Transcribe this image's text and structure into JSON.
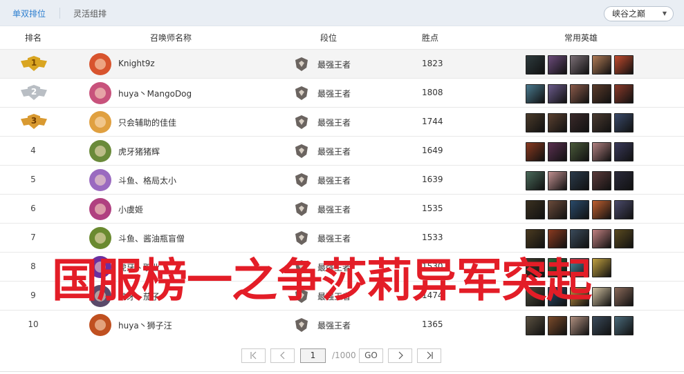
{
  "tabs": [
    {
      "label": "单双排位",
      "active": true
    },
    {
      "label": "灵活组排",
      "active": false
    }
  ],
  "region_select": {
    "value": "峡谷之巅",
    "chevron_icon": "chevron-down-icon"
  },
  "columns": [
    "排名",
    "召唤师名称",
    "段位",
    "胜点",
    "常用英雄"
  ],
  "rows": [
    {
      "rank": "1",
      "medal": "gold",
      "summoner": "Knight9z",
      "tier": "最强王者",
      "lp": "1823",
      "avatar_color": "#d8542e",
      "heroes": [
        "#2d3a3d",
        "#6b4b7a",
        "#7a6e75",
        "#b07a55",
        "#c24b2e"
      ]
    },
    {
      "rank": "2",
      "medal": "silver",
      "summoner": "huya丶MangoDog",
      "tier": "最强王者",
      "lp": "1808",
      "avatar_color": "#c8527c",
      "heroes": [
        "#4a7a8f",
        "#6a5a8a",
        "#8a5a4a",
        "#5a3a2a",
        "#8a3a2a"
      ]
    },
    {
      "rank": "3",
      "medal": "bronze",
      "summoner": "只会辅助的佳佳",
      "tier": "最强王者",
      "lp": "1744",
      "avatar_color": "#e0a040",
      "heroes": [
        "#4a3a2a",
        "#5a4030",
        "#3a2a2a",
        "#4a3a30",
        "#3a4a6a"
      ]
    },
    {
      "rank": "4",
      "medal": "",
      "summoner": "虎牙猪猪辉",
      "tier": "最强王者",
      "lp": "1649",
      "avatar_color": "#6a8a3a",
      "heroes": [
        "#8a3a20",
        "#5a3050",
        "#4a5a3a",
        "#b08080",
        "#3a3a5a"
      ]
    },
    {
      "rank": "5",
      "medal": "",
      "summoner": "斗鱼、格局太小",
      "tier": "最强王者",
      "lp": "1639",
      "avatar_color": "#9a6ac0",
      "heroes": [
        "#4a6a5a",
        "#c09090",
        "#2a3a4a",
        "#5a3a3a",
        "#2a2a3a"
      ]
    },
    {
      "rank": "6",
      "medal": "",
      "summoner": "小虞姬",
      "tier": "最强王者",
      "lp": "1535",
      "avatar_color": "#b04080",
      "heroes": [
        "#3a3020",
        "#6a4a3a",
        "#2a4a6a",
        "#c06030",
        "#4a4a6a"
      ]
    },
    {
      "rank": "7",
      "medal": "",
      "summoner": "斗鱼、酱油瓶盲僧",
      "tier": "最强王者",
      "lp": "1533",
      "avatar_color": "#6a8a30",
      "heroes": [
        "#4a3a20",
        "#8a3a20",
        "#3a4a5a",
        "#c08080",
        "#5a4a20"
      ]
    },
    {
      "rank": "8",
      "medal": "",
      "summoner": "虎牙丶职业",
      "tier": "最强王者",
      "lp": "1530",
      "avatar_color": "#6a30a0",
      "heroes": [
        "#3a3a2a",
        "#2a6a3a",
        "#4a8aa0",
        "#c0a040"
      ]
    },
    {
      "rank": "9",
      "medal": "",
      "summoner": "虎牙丶茄子",
      "tier": "最强王者",
      "lp": "1474",
      "avatar_color": "#5a4a6a",
      "heroes": [
        "#4a4a3a",
        "#2a4a6a",
        "#c09040",
        "#d0c0a0",
        "#8a6a5a"
      ]
    },
    {
      "rank": "10",
      "medal": "",
      "summoner": "huya丶狮子汪",
      "tier": "最强王者",
      "lp": "1365",
      "avatar_color": "#c05020",
      "heroes": [
        "#5a5040",
        "#7a4a2a",
        "#b09080",
        "#3a4a5a",
        "#4a6a7a"
      ]
    }
  ],
  "overlay_title": "国服榜一之争莎莉异军突起",
  "pagination": {
    "first_icon": "first-page-icon",
    "prev_icon": "prev-page-icon",
    "next_icon": "next-page-icon",
    "last_icon": "last-page-icon",
    "current_page": "1",
    "total": "/1000",
    "go_label": "GO"
  }
}
